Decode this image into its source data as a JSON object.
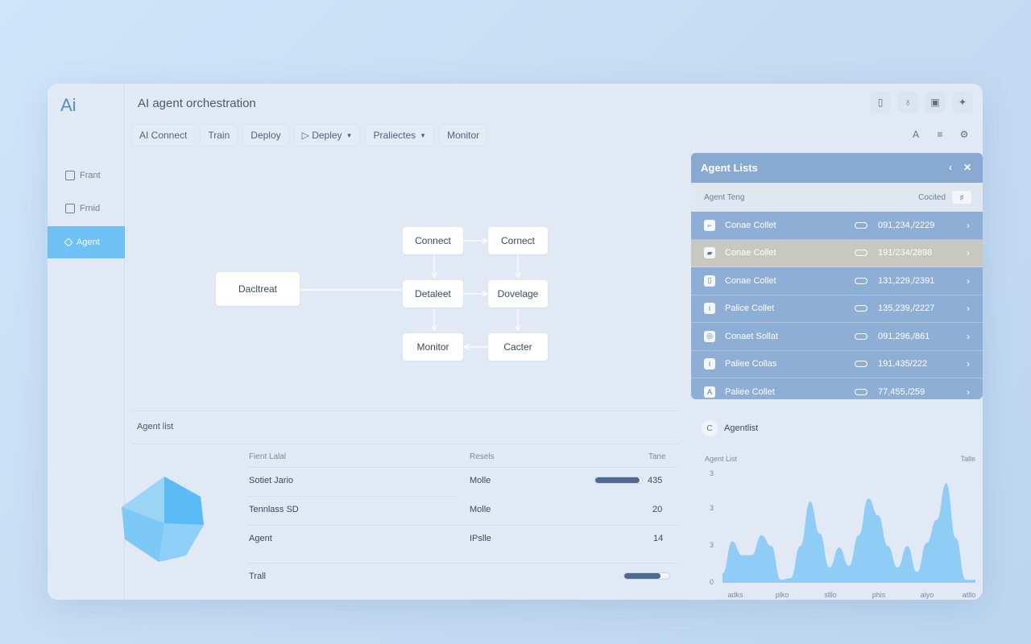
{
  "app": {
    "logo": "Ai",
    "title": "AI agent orchestration"
  },
  "nav": [
    {
      "label": "AI Connect",
      "caret": false
    },
    {
      "label": "Train",
      "caret": false
    },
    {
      "label": "Deploy",
      "caret": false
    },
    {
      "label": "▷ Depley",
      "caret": true
    },
    {
      "label": "Praliectes",
      "caret": true
    },
    {
      "label": "Monitor",
      "caret": false
    }
  ],
  "sidebar": {
    "items": [
      {
        "label": "Frant",
        "icon": "pipeline-icon"
      },
      {
        "label": "Frnid",
        "icon": "document-icon"
      },
      {
        "label": "Agent",
        "icon": "agent-icon",
        "active": true
      }
    ]
  },
  "toolbar_icons": [
    "phone-icon",
    "bulb-icon",
    "window-icon",
    "sparkle-icon"
  ],
  "toolbar_icons2": [
    {
      "name": "font-icon",
      "glyph": "A"
    },
    {
      "name": "list-icon",
      "glyph": "≡"
    },
    {
      "name": "settings-icon",
      "glyph": "⚙"
    }
  ],
  "flow": {
    "nodes": [
      {
        "id": "n1",
        "label": "Dacltreat"
      },
      {
        "id": "n2",
        "label": "Connect"
      },
      {
        "id": "n3",
        "label": "Cornect"
      },
      {
        "id": "n4",
        "label": "Detaleet"
      },
      {
        "id": "n5",
        "label": "Dovelage"
      },
      {
        "id": "n6",
        "label": "Monitor"
      },
      {
        "id": "n7",
        "label": "Cacter"
      }
    ]
  },
  "agent_panel": {
    "title": "Agent Lists",
    "sub_left": "Agent Teng",
    "sub_right": "Cocited",
    "sub_box": "♯",
    "rows": [
      {
        "icon": "⌐",
        "name": "Conae Collet",
        "value": "091,234,/2229",
        "highlight": false
      },
      {
        "icon": "▰",
        "name": "Conae Collet",
        "value": "191/234/2898",
        "highlight": true
      },
      {
        "icon": "▯",
        "name": "Conae Collet",
        "value": "131,229,/2391",
        "highlight": false
      },
      {
        "icon": "i",
        "name": "Palice Collet",
        "value": "135,239,/2227",
        "highlight": false
      },
      {
        "icon": "◎",
        "name": "Conaet Sollat",
        "value": "091,296,/861",
        "highlight": false
      },
      {
        "icon": "i",
        "name": "Paliee Collas",
        "value": "191,435/222",
        "highlight": false
      },
      {
        "icon": "A",
        "name": "Paliee Collet",
        "value": "77,455,/259",
        "highlight": false
      }
    ]
  },
  "agent_list": {
    "title": "Agent list",
    "columns": [
      "Fient Lalal",
      "Resels",
      "Tane"
    ],
    "rows": [
      {
        "name": "Sotiet Jario",
        "resel": "Molle",
        "value": "435",
        "progress": 0.95
      },
      {
        "name": "Tennlass SD",
        "resel": "Molle",
        "value": "20"
      },
      {
        "name": "Agent",
        "resel": "IPslle",
        "value": "14"
      }
    ],
    "footer": {
      "label": "Trall",
      "progress": 0.8
    }
  },
  "chart_panel": {
    "title": "Agentlist",
    "badge": "C"
  },
  "chart_data": {
    "type": "area",
    "xlabel": "Agent List",
    "ylabel": "Talle",
    "yticks": [
      "3",
      "3",
      "3",
      "0"
    ],
    "xticks": [
      "adks",
      "plko",
      "slllo",
      "phis",
      "alyo",
      "atllo"
    ],
    "x": [
      0,
      2,
      4,
      6,
      8,
      10,
      12,
      14,
      16,
      18,
      20,
      22,
      24,
      26,
      28,
      30,
      32,
      34,
      36,
      38,
      40,
      42,
      44,
      46,
      48,
      50,
      52
    ],
    "values": [
      0.3,
      1.35,
      0.9,
      0.9,
      1.55,
      1.2,
      0.1,
      0.15,
      1.2,
      2.65,
      1.6,
      0.5,
      1.15,
      0.55,
      1.55,
      2.75,
      2.2,
      1.2,
      0.5,
      1.2,
      0.35,
      1.3,
      2.05,
      3.25,
      1.45,
      0.1,
      0.1
    ],
    "ylim": [
      0,
      3.6
    ],
    "color": "#8fcdf7"
  },
  "colors": {
    "accent": "#6ec0f5",
    "panel": "#8faed5",
    "highlight": "#c7c8bf"
  }
}
